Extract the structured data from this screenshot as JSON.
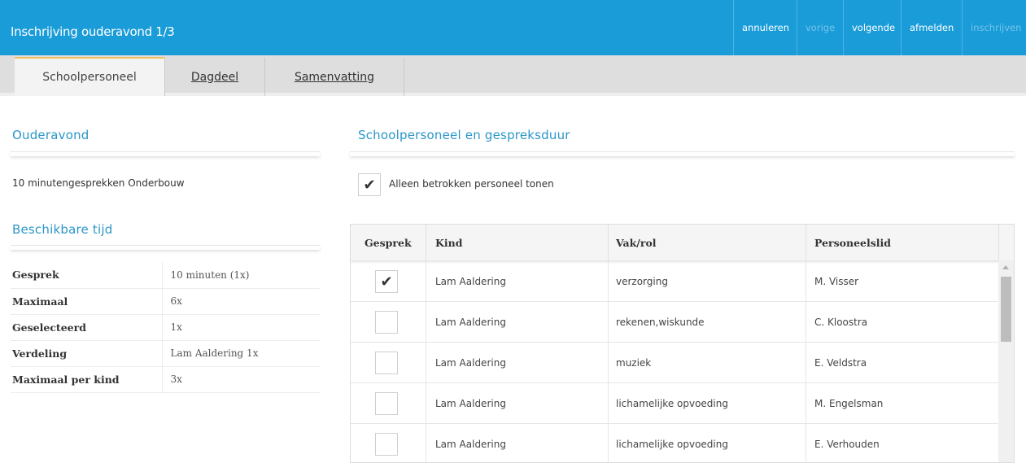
{
  "header": {
    "title": "Inschrijving ouderavond 1/3",
    "actions": [
      {
        "label": "annuleren",
        "enabled": true
      },
      {
        "label": "vorige",
        "enabled": false
      },
      {
        "label": "volgende",
        "enabled": true
      },
      {
        "label": "afmelden",
        "enabled": true
      },
      {
        "label": "inschrijven",
        "enabled": false
      }
    ]
  },
  "tabs": [
    {
      "label": "Schoolpersoneel",
      "active": true
    },
    {
      "label": "Dagdeel",
      "active": false
    },
    {
      "label": "Samenvatting",
      "active": false
    }
  ],
  "left": {
    "ouderavond_title": "Ouderavond",
    "ouderavond_value": "10 minutengesprekken Onderbouw",
    "tijd_title": "Beschikbare tijd",
    "rows": [
      {
        "key": "Gesprek",
        "value": "10 minuten (1x)"
      },
      {
        "key": "Maximaal",
        "value": "6x"
      },
      {
        "key": "Geselecteerd",
        "value": "1x"
      },
      {
        "key": "Verdeling",
        "value": "Lam Aaldering 1x"
      },
      {
        "key": "Maximaal per kind",
        "value": "3x"
      }
    ]
  },
  "right": {
    "title": "Schoolpersoneel en gespreksduur",
    "filter_label": "Alleen betrokken personeel tonen",
    "filter_checked": true,
    "columns": [
      "Gesprek",
      "Kind",
      "Vak/rol",
      "Personeelslid"
    ],
    "rows": [
      {
        "checked": true,
        "kind": "Lam Aaldering",
        "vak": "verzorging",
        "personeel": "M. Visser"
      },
      {
        "checked": false,
        "kind": "Lam Aaldering",
        "vak": "rekenen,wiskunde",
        "personeel": "C. Kloostra"
      },
      {
        "checked": false,
        "kind": "Lam Aaldering",
        "vak": "muziek",
        "personeel": "E. Veldstra"
      },
      {
        "checked": false,
        "kind": "Lam Aaldering",
        "vak": "lichamelijke opvoeding",
        "personeel": "M. Engelsman"
      },
      {
        "checked": false,
        "kind": "Lam Aaldering",
        "vak": "lichamelijke opvoeding",
        "personeel": "E. Verhouden"
      }
    ]
  },
  "icons": {
    "check": "check-icon"
  },
  "colors": {
    "accent": "#1a9cd8",
    "section": "#2a96c8",
    "tab_active_border": "#f0c060"
  }
}
